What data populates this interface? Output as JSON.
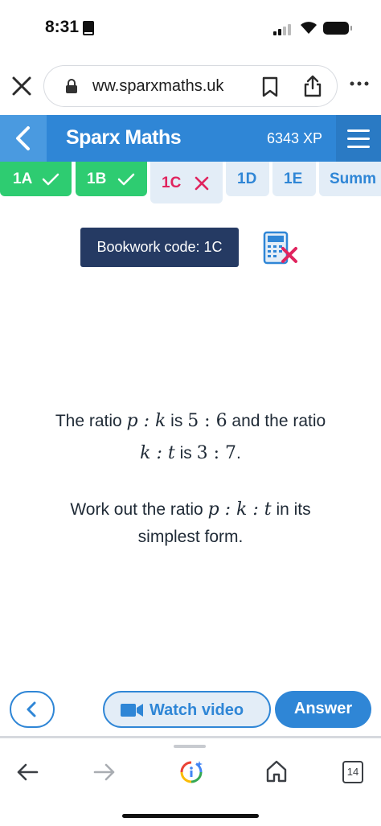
{
  "status": {
    "time": "8:31"
  },
  "browser": {
    "url": "ww.sparxmaths.uk",
    "tab_count": "14"
  },
  "header": {
    "title": "Sparx Maths",
    "xp": "6343 XP"
  },
  "tabs": [
    {
      "label": "1A",
      "state": "done"
    },
    {
      "label": "1B",
      "state": "done"
    },
    {
      "label": "1C",
      "state": "current-incorrect"
    },
    {
      "label": "1D",
      "state": "todo"
    },
    {
      "label": "1E",
      "state": "todo"
    },
    {
      "label": "Summ",
      "state": "todo"
    }
  ],
  "bookwork": {
    "label": "Bookwork code: 1C"
  },
  "question": {
    "line1": {
      "a": "The ratio ",
      "m1": "p : k",
      "b": " is ",
      "m2": "5 : 6",
      "c": " and the ratio"
    },
    "line2": {
      "m1": "k : t",
      "b": " is ",
      "m2": "3 : 7",
      "c": "."
    },
    "line3": {
      "a": "Work out the ratio ",
      "m1": "p : k : t",
      "b": " in its"
    },
    "line4": {
      "a": "simplest form."
    }
  },
  "controls": {
    "watch_video": "Watch video",
    "answer": "Answer"
  },
  "colors": {
    "brand_blue": "#2f86d6",
    "done_green": "#2ecc71",
    "wrong_red": "#e0245e",
    "badge_navy": "#253a63"
  }
}
